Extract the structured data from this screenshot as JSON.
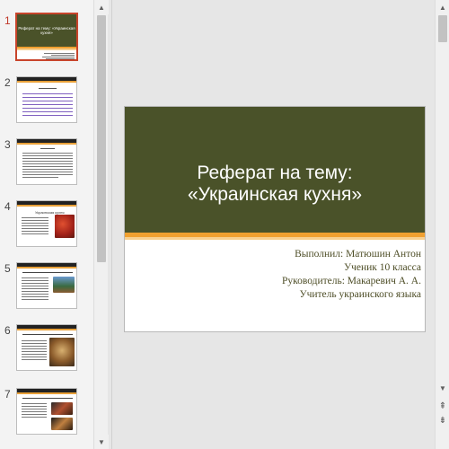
{
  "thumbnails": {
    "numbers": [
      "1",
      "2",
      "3",
      "4",
      "5",
      "6",
      "7"
    ],
    "active_index": 0,
    "slide1_title": "Реферат на тему: «Украинская кухня»",
    "slide4_heading": "Украинская кухня"
  },
  "slide": {
    "title_line1": "Реферат на тему:",
    "title_line2": "«Украинская кухня»",
    "author": "Выполнил: Матюшин Антон",
    "grade": "Ученик 10 класса",
    "supervisor": "Руководитель: Макаревич А. А.",
    "supervisor_role": "Учитель украинского языка"
  },
  "colors": {
    "title_band": "#4a5229",
    "stripe_orange": "#f0a030",
    "stripe_light": "#f8d090",
    "active_border": "#c8442b",
    "subtitle_text": "#4d4d26"
  },
  "icons": {
    "scroll_up": "triangle-up",
    "scroll_down": "triangle-down",
    "prev_slide": "double-chevron-up",
    "next_slide": "double-chevron-down"
  }
}
